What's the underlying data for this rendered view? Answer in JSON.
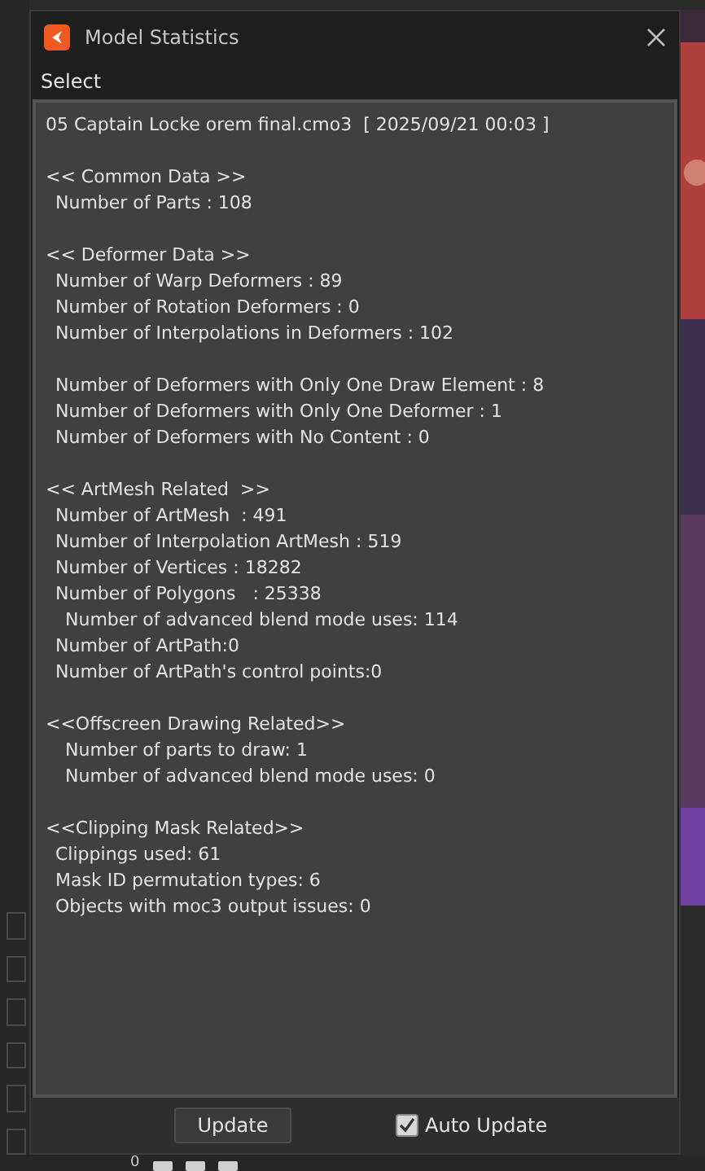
{
  "window": {
    "title": "Model Statistics"
  },
  "menu": [
    "Select"
  ],
  "file_line": "05 Captain Locke orem final.cmo3  [ 2025/09/21 00:03 ]",
  "sections": [
    {
      "heading": "<< Common Data >>",
      "groups": [
        [
          {
            "kind": "item",
            "text": "Number of Parts : 108"
          }
        ]
      ]
    },
    {
      "heading": "<< Deformer Data >>",
      "groups": [
        [
          {
            "kind": "item",
            "text": "Number of Warp Deformers : 89"
          },
          {
            "kind": "item",
            "text": "Number of Rotation Deformers : 0"
          },
          {
            "kind": "item",
            "text": "Number of Interpolations in Deformers : 102"
          }
        ],
        [
          {
            "kind": "item",
            "text": "Number of Deformers with Only One Draw Element : 8"
          },
          {
            "kind": "item",
            "text": "Number of Deformers with Only One Deformer : 1"
          },
          {
            "kind": "item",
            "text": "Number of Deformers with No Content : 0"
          }
        ]
      ]
    },
    {
      "heading": "<< ArtMesh Related  >>",
      "groups": [
        [
          {
            "kind": "item",
            "text": "Number of ArtMesh  : 491"
          },
          {
            "kind": "item",
            "text": "Number of Interpolation ArtMesh : 519"
          },
          {
            "kind": "item",
            "text": "Number of Vertices : 18282"
          },
          {
            "kind": "item",
            "text": "Number of Polygons   : 25338"
          },
          {
            "kind": "subitem",
            "text": "Number of advanced blend mode uses: 114"
          },
          {
            "kind": "item",
            "text": "Number of ArtPath:0"
          },
          {
            "kind": "item",
            "text": "Number of ArtPath's control points:0"
          }
        ]
      ]
    },
    {
      "heading": "<<Offscreen Drawing Related>>",
      "groups": [
        [
          {
            "kind": "subitem",
            "text": "Number of parts to draw: 1"
          },
          {
            "kind": "subitem",
            "text": "Number of advanced blend mode uses: 0"
          }
        ]
      ]
    },
    {
      "heading": "<<Clipping Mask Related>>",
      "groups": [
        [
          {
            "kind": "item",
            "text": "Clippings used: 61"
          },
          {
            "kind": "item",
            "text": "Mask ID permutation types: 6"
          },
          {
            "kind": "item",
            "text": "Objects with moc3 output issues: 0"
          }
        ]
      ]
    }
  ],
  "footer": {
    "button": "Update",
    "checkbox": {
      "label": "Auto Update",
      "checked": true
    }
  },
  "background": {
    "counter": "0"
  }
}
